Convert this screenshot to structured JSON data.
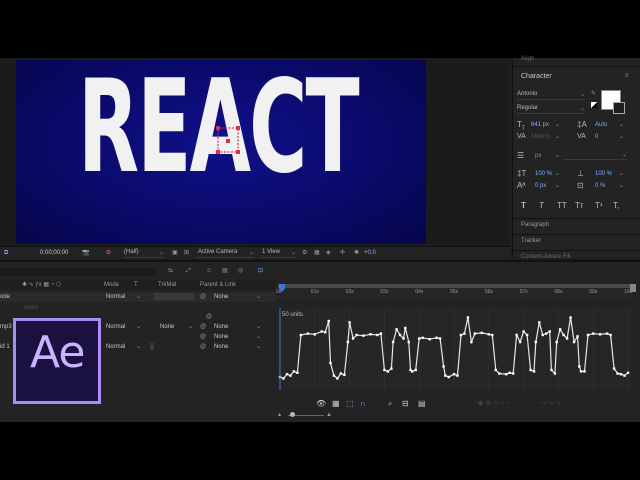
{
  "composition": {
    "title_text": "REACT",
    "bg_color": "#0a0a6e",
    "text_color": "#f1f1f1"
  },
  "viewer_bar": {
    "timecode": "0;00;00;00",
    "resolution": "(Half)",
    "camera": "Active Camera",
    "views": "1 View",
    "exposure": "+0,0"
  },
  "character_panel": {
    "top_label": "Align",
    "title": "Character",
    "font_family": "Antonio",
    "font_style": "Regular",
    "font_size": "641 px",
    "leading": "Auto",
    "kerning": "Metrics",
    "tracking": "0",
    "stroke_width": "px",
    "vertical_scale": "100 %",
    "horizontal_scale": "100 %",
    "baseline_shift": "0 px",
    "tsume": "0 %",
    "style_buttons": [
      "T",
      "T",
      "TT",
      "Tт",
      "T¹",
      "T,"
    ],
    "paragraph_label": "Paragraph",
    "tracker_label": "Tracker",
    "content_aware_label": "Content-Aware Fill"
  },
  "timeline": {
    "columns": {
      "mode": "Mode",
      "t": "T",
      "trkmat": "TrkMat",
      "parent": "Parent & Link"
    },
    "rows": [
      {
        "left": "ode",
        "mode": "Normal",
        "trkmat": "",
        "parent": "None"
      },
      {
        "left": "",
        "mode": "",
        "trkmat": "",
        "parent": ""
      },
      {
        "left": "mp3",
        "mode": "Normal",
        "trkmat": "None",
        "parent": "None"
      },
      {
        "left": "",
        "mode": "",
        "trkmat": "",
        "parent": "None"
      },
      {
        "left": "id 1",
        "mode": "Normal",
        "trkmat": "",
        "parent": "None"
      }
    ],
    "dim_labels": [
      "listen",
      "n"
    ],
    "ruler_ticks": [
      "0s",
      "01s",
      "02s",
      "03s",
      "04s",
      "05s",
      "06s",
      "07s",
      "08s",
      "09s",
      "10s"
    ],
    "graph_label": "50 units",
    "app_badge": "Ae"
  },
  "chart_data": {
    "type": "line",
    "title": "",
    "xlabel": "",
    "ylabel": "",
    "xlim": [
      0,
      10
    ],
    "ylim": [
      0,
      100
    ],
    "series": [
      {
        "values": [
          [
            0.0,
            10
          ],
          [
            0.1,
            8
          ],
          [
            0.2,
            14
          ],
          [
            0.3,
            12
          ],
          [
            0.4,
            18
          ],
          [
            0.5,
            16
          ],
          [
            0.6,
            70
          ],
          [
            0.8,
            72
          ],
          [
            1.0,
            71
          ],
          [
            1.2,
            75
          ],
          [
            1.3,
            74
          ],
          [
            1.4,
            90
          ],
          [
            1.45,
            30
          ],
          [
            1.55,
            12
          ],
          [
            1.65,
            8
          ],
          [
            1.75,
            15
          ],
          [
            1.85,
            13
          ],
          [
            1.95,
            60
          ],
          [
            2.0,
            88
          ],
          [
            2.1,
            65
          ],
          [
            2.2,
            70
          ],
          [
            2.4,
            69
          ],
          [
            2.6,
            71
          ],
          [
            2.8,
            70
          ],
          [
            2.9,
            72
          ],
          [
            3.0,
            20
          ],
          [
            3.1,
            18
          ],
          [
            3.2,
            22
          ],
          [
            3.25,
            60
          ],
          [
            3.35,
            78
          ],
          [
            3.45,
            70
          ],
          [
            3.55,
            65
          ],
          [
            3.6,
            80
          ],
          [
            3.7,
            60
          ],
          [
            3.75,
            20
          ],
          [
            3.8,
            18
          ],
          [
            3.9,
            20
          ],
          [
            4.0,
            65
          ],
          [
            4.1,
            66
          ],
          [
            4.3,
            64
          ],
          [
            4.5,
            66
          ],
          [
            4.6,
            65
          ],
          [
            4.7,
            25
          ],
          [
            4.75,
            12
          ],
          [
            4.85,
            10
          ],
          [
            5.0,
            14
          ],
          [
            5.1,
            12
          ],
          [
            5.2,
            70
          ],
          [
            5.3,
            72
          ],
          [
            5.4,
            95
          ],
          [
            5.5,
            60
          ],
          [
            5.6,
            72
          ],
          [
            5.8,
            73
          ],
          [
            6.0,
            71
          ],
          [
            6.1,
            70
          ],
          [
            6.2,
            20
          ],
          [
            6.3,
            15
          ],
          [
            6.5,
            14
          ],
          [
            6.6,
            16
          ],
          [
            6.7,
            15
          ],
          [
            6.8,
            70
          ],
          [
            6.9,
            60
          ],
          [
            7.0,
            75
          ],
          [
            7.1,
            70
          ],
          [
            7.2,
            20
          ],
          [
            7.3,
            18
          ],
          [
            7.35,
            60
          ],
          [
            7.45,
            88
          ],
          [
            7.55,
            70
          ],
          [
            7.65,
            72
          ],
          [
            7.75,
            75
          ],
          [
            7.8,
            20
          ],
          [
            7.9,
            15
          ],
          [
            7.95,
            60
          ],
          [
            8.05,
            78
          ],
          [
            8.15,
            70
          ],
          [
            8.25,
            65
          ],
          [
            8.35,
            95
          ],
          [
            8.45,
            60
          ],
          [
            8.55,
            68
          ],
          [
            8.6,
            25
          ],
          [
            8.65,
            18
          ],
          [
            8.75,
            18
          ],
          [
            8.85,
            70
          ],
          [
            9.0,
            72
          ],
          [
            9.2,
            71
          ],
          [
            9.4,
            72
          ],
          [
            9.5,
            70
          ],
          [
            9.6,
            22
          ],
          [
            9.7,
            15
          ],
          [
            9.8,
            14
          ],
          [
            9.9,
            12
          ],
          [
            10.0,
            16
          ]
        ]
      }
    ],
    "line_color": "#e8e8e8"
  }
}
